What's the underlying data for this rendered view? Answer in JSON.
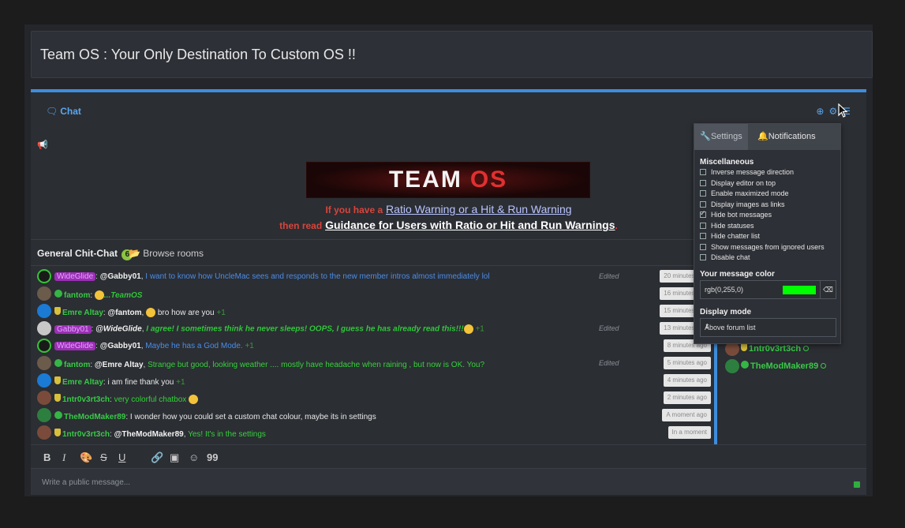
{
  "page": {
    "title": "Team OS : Your Only Destination To Custom OS !!"
  },
  "chat": {
    "tab_label": "Chat",
    "tab_icon": "chat-bubbles-icon",
    "head_icons": [
      "globe-icon",
      "gear-icon",
      "menu-icon"
    ],
    "banner": {
      "word1": "TEAM",
      "word2": "OS"
    },
    "notice": {
      "line1_prefix": "If you have a",
      "line1_link": "Ratio Warning or a Hit & Run Warning",
      "line2_prefix": "then read",
      "line2_link": "Guidance for Users with Ratio or Hit and Run Warnings",
      "line2_suffix": "."
    },
    "room": {
      "name": "General Chit-Chat",
      "count": "6",
      "browse_label": "Browse rooms"
    },
    "messages": [
      {
        "user": "WideGlide",
        "target": "@Gabby01",
        "text": "I want to know how UncleMac sees and responds to the new member intros almost immediately lol",
        "edited": "Edited",
        "time": "20 minutes ago"
      },
      {
        "user": "fantom",
        "text": "...TeamOS",
        "time": "16 minutes ago"
      },
      {
        "user": "Emre Altay",
        "target": "@fantom",
        "text": "bro how are you",
        "plus": "+1",
        "time": "15 minutes ago"
      },
      {
        "user": "Gabby01",
        "target": "@WideGlide",
        "text": "I agree! I sometimes think he never sleeps! OOPS, I guess he has already read this!!!",
        "plus": "+1",
        "edited": "Edited",
        "time": "13 minutes ago"
      },
      {
        "user": "WideGlide",
        "target": "@Gabby01",
        "text": "Maybe he has a God Mode.",
        "plus": "+1",
        "time": "8 minutes ago"
      },
      {
        "user": "fantom",
        "target": "@Emre Altay",
        "text": "Strange but good, looking weather .... mostly have headache when raining , but now is OK. You?",
        "edited": "Edited",
        "time": "5 minutes ago"
      },
      {
        "user": "Emre Altay",
        "text": "i am fine thank you",
        "plus": "+1",
        "time": "4 minutes ago"
      },
      {
        "user": "1ntr0v3rt3ch",
        "text": "very colorful chatbox",
        "time": "2 minutes ago"
      },
      {
        "user": "TheModMaker89",
        "text": "I wonder how you could set a custom chat colour, maybe its in settings",
        "time": "A moment ago"
      },
      {
        "user": "1ntr0v3rt3ch",
        "target": "@TheModMaker89",
        "text": "Yes! It's in the settings",
        "time": "In a moment"
      }
    ],
    "sidebar_users": [
      "1ntr0v3rt3ch",
      "TheModMaker89"
    ],
    "toolbar_icons": [
      "bold-icon",
      "italic-icon",
      "palette-icon",
      "strikethrough-icon",
      "underline-icon",
      "link-icon",
      "image-icon",
      "smiley-icon",
      "quote-icon"
    ],
    "toolbar_labels": {
      "bold": "B",
      "italic": "I",
      "strike": "S",
      "underline": "U",
      "quote": "99"
    },
    "input_placeholder": "Write a public message..."
  },
  "settings_popup": {
    "tabs": [
      "Settings",
      "Notifications"
    ],
    "misc_title": "Miscellaneous",
    "options": [
      {
        "label": "Inverse message direction",
        "checked": false
      },
      {
        "label": "Display editor on top",
        "checked": false
      },
      {
        "label": "Enable maximized mode",
        "checked": false
      },
      {
        "label": "Display images as links",
        "checked": false
      },
      {
        "label": "Hide bot messages",
        "checked": true
      },
      {
        "label": "Hide statuses",
        "checked": false
      },
      {
        "label": "Hide chatter list",
        "checked": false
      },
      {
        "label": "Show messages from ignored users",
        "checked": false
      },
      {
        "label": "Disable chat",
        "checked": false
      }
    ],
    "color_title": "Your message color",
    "color_value": "rgb(0,255,0)",
    "color_hex": "#00ff00",
    "display_title": "Display mode",
    "display_value": "Above forum list"
  },
  "colors": {
    "accent": "#3c8dde",
    "green": "#38c947",
    "purple": "#9b2fb5"
  }
}
